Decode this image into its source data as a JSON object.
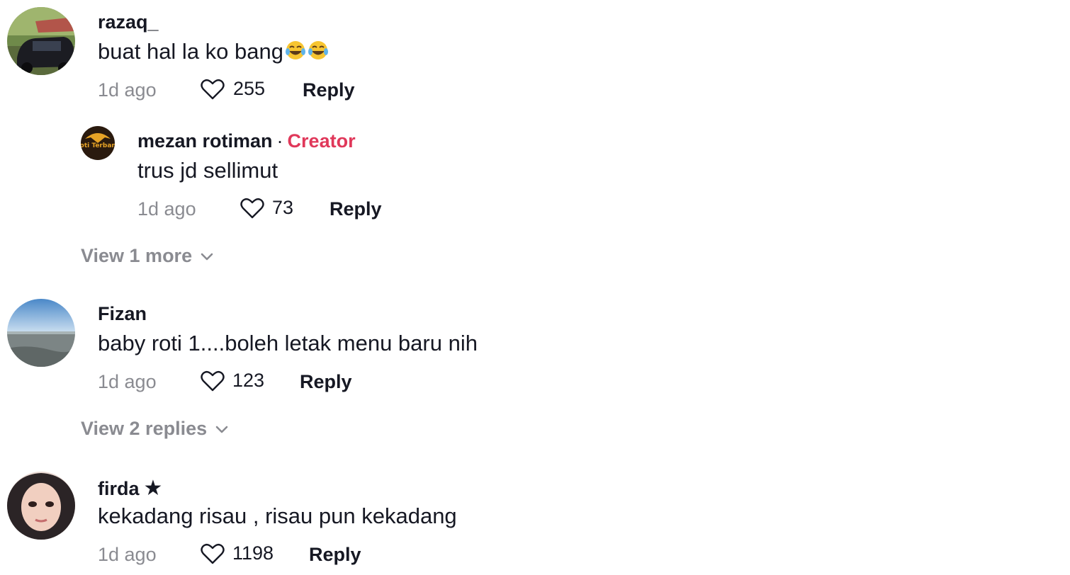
{
  "comments": [
    {
      "username": "razaq_",
      "text": "buat hal la ko bang",
      "emoji": [
        "joy-emoji",
        "joy-emoji"
      ],
      "time": "1d ago",
      "likes": "255",
      "reply_label": "Reply",
      "replies": [
        {
          "username": "mezan rotiman",
          "separator": "·",
          "badge": "Creator",
          "text": "trus jd sellimut",
          "time": "1d ago",
          "likes": "73",
          "reply_label": "Reply",
          "avatar_text": "Roti Terbang"
        }
      ],
      "view_more_label": "View 1 more"
    },
    {
      "username": "Fizan",
      "text": "baby roti 1....boleh letak menu baru nih",
      "time": "1d ago",
      "likes": "123",
      "reply_label": "Reply",
      "view_more_label": "View 2 replies"
    },
    {
      "username": "firda",
      "username_suffix_icon": "star-icon",
      "username_suffix": "★",
      "text": "kekadang risau , risau pun kekadang",
      "time": "1d ago",
      "likes": "1198",
      "reply_label": "Reply"
    }
  ],
  "colors": {
    "text": "#161823",
    "muted": "#8a8b91",
    "creator": "#e0385a"
  },
  "icons": {
    "like": "heart-outline-icon",
    "expand": "chevron-down-icon"
  }
}
